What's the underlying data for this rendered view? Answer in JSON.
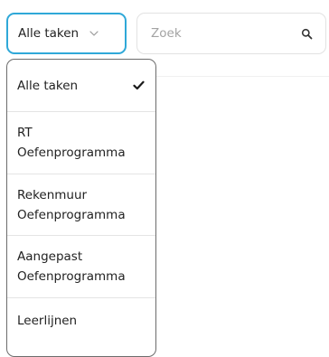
{
  "filter": {
    "selected_label": "Alle taken",
    "icon": "chevron-down-icon"
  },
  "search": {
    "placeholder": "Zoek",
    "value": "",
    "icon": "search-icon"
  },
  "dropdown": {
    "options": [
      {
        "lines": [
          "Alle taken"
        ],
        "selected": true
      },
      {
        "lines": [
          "RT",
          "Oefenprogramma"
        ],
        "selected": false
      },
      {
        "lines": [
          "Rekenmuur",
          "Oefenprogramma"
        ],
        "selected": false
      },
      {
        "lines": [
          "Aangepast",
          "Oefenprogramma"
        ],
        "selected": false
      },
      {
        "lines": [
          "Leerlijnen"
        ],
        "selected": false
      }
    ],
    "selected_icon": "check-icon"
  },
  "colors": {
    "accent": "#2fa8d8",
    "text": "#222222",
    "placeholder": "#a3a3a3",
    "border": "#e2e2e2",
    "dropdown_border": "#6c6c6c"
  }
}
